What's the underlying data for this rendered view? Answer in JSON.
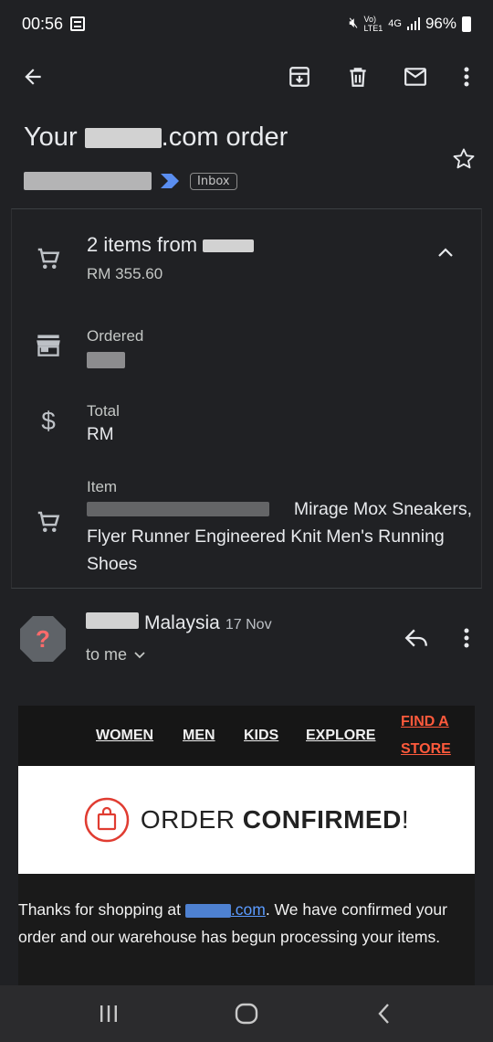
{
  "status_bar": {
    "time": "00:56",
    "network_top": "Vo)",
    "network_bottom": "LTE1",
    "network_type": "4G",
    "battery": "96%"
  },
  "toolbar": {
    "back_icon": "arrow-left-icon",
    "archive_icon": "archive-icon",
    "delete_icon": "trash-icon",
    "mark_unread_icon": "mail-icon",
    "more_icon": "more-vert-icon"
  },
  "email": {
    "subject_prefix": "Your ",
    "subject_suffix": ".com order",
    "label": "Inbox",
    "star_icon": "star-outline-icon"
  },
  "summary": {
    "items_title": "2 items from",
    "items_price": "RM 355.60",
    "ordered_label": "Ordered",
    "total_label": "Total",
    "total_value": "RM",
    "item_label": "Item",
    "item_name_line1": "Mirage Mox Sneakers,",
    "item_name_line2": "Flyer Runner Engineered Knit Men's Running",
    "item_name_line3": "Shoes"
  },
  "message": {
    "sender_suffix": "Malaysia",
    "date": "17 Nov",
    "to": "to me",
    "avatar_glyph": "?"
  },
  "email_content": {
    "nav": [
      "WOMEN",
      "MEN",
      "KIDS",
      "EXPLORE"
    ],
    "find_store_line1": "FIND A",
    "find_store_line2": "STORE",
    "banner_light": "ORDER ",
    "banner_bold": "CONFIRMED",
    "banner_end": "!",
    "body_before_link": "Thanks for shopping at ",
    "body_link": ".com",
    "body_after_link": ". We have confirmed your order and our warehouse has begun processing your items."
  },
  "colors": {
    "background": "#202124",
    "accent_red": "#ff5a3c",
    "link_blue": "#5b9bff",
    "avatar_red": "#ff6b6b"
  }
}
